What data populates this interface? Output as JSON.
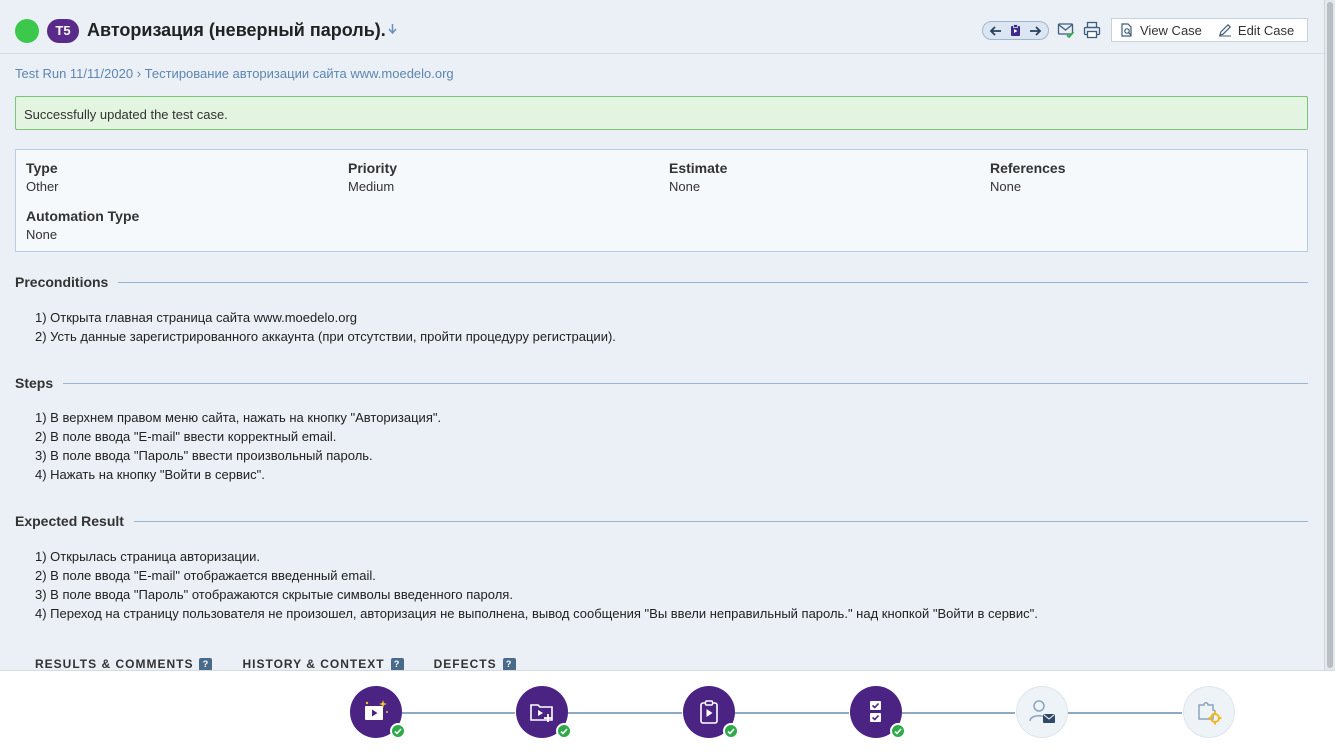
{
  "header": {
    "case_id": "T5",
    "title": "Авторизация (неверный пароль).",
    "view_case": "View Case",
    "edit_case": "Edit Case"
  },
  "breadcrumb": {
    "run": "Test Run 11/11/2020",
    "separator": "›",
    "suite": "Тестирование авторизации сайта www.moedelo.org"
  },
  "message": "Successfully updated the test case.",
  "fields": {
    "type": {
      "label": "Type",
      "value": "Other"
    },
    "priority": {
      "label": "Priority",
      "value": "Medium"
    },
    "estimate": {
      "label": "Estimate",
      "value": "None"
    },
    "references": {
      "label": "References",
      "value": "None"
    },
    "automation_type": {
      "label": "Automation Type",
      "value": "None"
    }
  },
  "preconditions": {
    "title": "Preconditions",
    "lines": [
      "1) Открыта главная страница сайта www.moedelo.org",
      "2) Усть данные зарегистрированного аккаунта (при отсутствии, пройти процедуру регистрации)."
    ]
  },
  "steps": {
    "title": "Steps",
    "lines": [
      "1) В верхнем правом меню сайта, нажать на кнопку \"Авторизация\".",
      "2) В поле ввода \"E-mail\" ввести корректный email.",
      "3) В поле ввода \"Пароль\" ввести произвольный пароль.",
      "4) Нажать на кнопку \"Войти в сервис\"."
    ]
  },
  "expected": {
    "title": "Expected Result",
    "lines": [
      "1) Открылась страница авторизации.",
      "2) В поле ввода \"E-mail\" отображается введенный email.",
      "3) В поле ввода \"Пароль\" отображаются скрытые символы введенного пароля.",
      "4) Переход на страницу пользователя не произошел, авторизация не выполнена, вывод сообщения \"Вы ввели неправильный пароль.\" над кнопкой \"Войти в сервис\"."
    ]
  },
  "tabs": [
    {
      "label": "RESULTS & COMMENTS",
      "help": "?"
    },
    {
      "label": "HISTORY & CONTEXT",
      "help": "?"
    },
    {
      "label": "DEFECTS",
      "help": "?"
    }
  ],
  "colors": {
    "status_passed": "#3cc84a",
    "accent_purple": "#4a2383",
    "link_blue": "#5e86b1",
    "success_bg": "#e3f4e0"
  },
  "onboarding_steps": [
    {
      "icon": "create-project-icon",
      "done": true
    },
    {
      "icon": "add-case-icon",
      "done": true
    },
    {
      "icon": "start-run-icon",
      "done": true
    },
    {
      "icon": "add-results-icon",
      "done": true
    },
    {
      "icon": "invite-user-icon",
      "done": false
    },
    {
      "icon": "setup-integration-icon",
      "done": false
    }
  ]
}
